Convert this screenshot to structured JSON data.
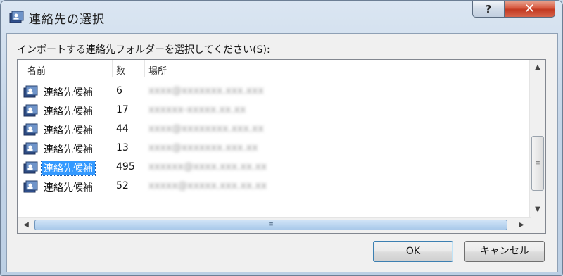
{
  "window": {
    "title": "連絡先の選択",
    "help_label": "?",
    "close_label": "✕"
  },
  "prompt": "インポートする連絡先フォルダーを選択してください(S):",
  "columns": {
    "name": "名前",
    "count": "数",
    "location": "場所"
  },
  "rows": [
    {
      "name": "連絡先候補",
      "count": "6",
      "location": "xxxx@xxxxxxx.xxx.xxx",
      "selected": false
    },
    {
      "name": "連絡先候補",
      "count": "17",
      "location": "xxxxxx-xxxxx.xx.xx",
      "selected": false
    },
    {
      "name": "連絡先候補",
      "count": "44",
      "location": "xxxx@xxxxxxxx.xxx.xx",
      "selected": false
    },
    {
      "name": "連絡先候補",
      "count": "13",
      "location": "xxxx@xxxxxxx.xxx.xx",
      "selected": false
    },
    {
      "name": "連絡先候補",
      "count": "495",
      "location": "xxxxxx@xxxx.xxx.xx.xx",
      "selected": true
    },
    {
      "name": "連絡先候補",
      "count": "52",
      "location": "xxxxx@xxxxx.xxx.xx.xx",
      "selected": false
    }
  ],
  "buttons": {
    "ok": "OK",
    "cancel": "キャンセル"
  },
  "scroll": {
    "up_arrow": "▲",
    "down_arrow": "▼",
    "left_arrow": "◀",
    "right_arrow": "▶",
    "grip": "≡"
  },
  "colors": {
    "selection": "#3399ff",
    "close_button": "#c23a22"
  }
}
